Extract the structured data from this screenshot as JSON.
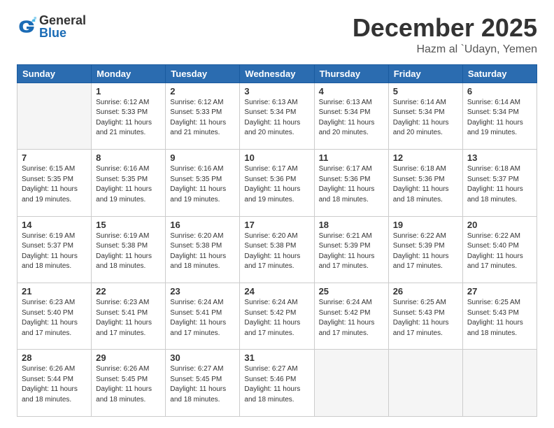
{
  "logo": {
    "general": "General",
    "blue": "Blue"
  },
  "header": {
    "month": "December 2025",
    "location": "Hazm al `Udayn, Yemen"
  },
  "days_of_week": [
    "Sunday",
    "Monday",
    "Tuesday",
    "Wednesday",
    "Thursday",
    "Friday",
    "Saturday"
  ],
  "weeks": [
    [
      {
        "day": "",
        "empty": true
      },
      {
        "day": "1",
        "sunrise": "6:12 AM",
        "sunset": "5:33 PM",
        "daylight": "11 hours and 21 minutes."
      },
      {
        "day": "2",
        "sunrise": "6:12 AM",
        "sunset": "5:33 PM",
        "daylight": "11 hours and 21 minutes."
      },
      {
        "day": "3",
        "sunrise": "6:13 AM",
        "sunset": "5:34 PM",
        "daylight": "11 hours and 20 minutes."
      },
      {
        "day": "4",
        "sunrise": "6:13 AM",
        "sunset": "5:34 PM",
        "daylight": "11 hours and 20 minutes."
      },
      {
        "day": "5",
        "sunrise": "6:14 AM",
        "sunset": "5:34 PM",
        "daylight": "11 hours and 20 minutes."
      },
      {
        "day": "6",
        "sunrise": "6:14 AM",
        "sunset": "5:34 PM",
        "daylight": "11 hours and 19 minutes."
      }
    ],
    [
      {
        "day": "7",
        "sunrise": "6:15 AM",
        "sunset": "5:35 PM",
        "daylight": "11 hours and 19 minutes."
      },
      {
        "day": "8",
        "sunrise": "6:16 AM",
        "sunset": "5:35 PM",
        "daylight": "11 hours and 19 minutes."
      },
      {
        "day": "9",
        "sunrise": "6:16 AM",
        "sunset": "5:35 PM",
        "daylight": "11 hours and 19 minutes."
      },
      {
        "day": "10",
        "sunrise": "6:17 AM",
        "sunset": "5:36 PM",
        "daylight": "11 hours and 19 minutes."
      },
      {
        "day": "11",
        "sunrise": "6:17 AM",
        "sunset": "5:36 PM",
        "daylight": "11 hours and 18 minutes."
      },
      {
        "day": "12",
        "sunrise": "6:18 AM",
        "sunset": "5:36 PM",
        "daylight": "11 hours and 18 minutes."
      },
      {
        "day": "13",
        "sunrise": "6:18 AM",
        "sunset": "5:37 PM",
        "daylight": "11 hours and 18 minutes."
      }
    ],
    [
      {
        "day": "14",
        "sunrise": "6:19 AM",
        "sunset": "5:37 PM",
        "daylight": "11 hours and 18 minutes."
      },
      {
        "day": "15",
        "sunrise": "6:19 AM",
        "sunset": "5:38 PM",
        "daylight": "11 hours and 18 minutes."
      },
      {
        "day": "16",
        "sunrise": "6:20 AM",
        "sunset": "5:38 PM",
        "daylight": "11 hours and 18 minutes."
      },
      {
        "day": "17",
        "sunrise": "6:20 AM",
        "sunset": "5:38 PM",
        "daylight": "11 hours and 17 minutes."
      },
      {
        "day": "18",
        "sunrise": "6:21 AM",
        "sunset": "5:39 PM",
        "daylight": "11 hours and 17 minutes."
      },
      {
        "day": "19",
        "sunrise": "6:22 AM",
        "sunset": "5:39 PM",
        "daylight": "11 hours and 17 minutes."
      },
      {
        "day": "20",
        "sunrise": "6:22 AM",
        "sunset": "5:40 PM",
        "daylight": "11 hours and 17 minutes."
      }
    ],
    [
      {
        "day": "21",
        "sunrise": "6:23 AM",
        "sunset": "5:40 PM",
        "daylight": "11 hours and 17 minutes."
      },
      {
        "day": "22",
        "sunrise": "6:23 AM",
        "sunset": "5:41 PM",
        "daylight": "11 hours and 17 minutes."
      },
      {
        "day": "23",
        "sunrise": "6:24 AM",
        "sunset": "5:41 PM",
        "daylight": "11 hours and 17 minutes."
      },
      {
        "day": "24",
        "sunrise": "6:24 AM",
        "sunset": "5:42 PM",
        "daylight": "11 hours and 17 minutes."
      },
      {
        "day": "25",
        "sunrise": "6:24 AM",
        "sunset": "5:42 PM",
        "daylight": "11 hours and 17 minutes."
      },
      {
        "day": "26",
        "sunrise": "6:25 AM",
        "sunset": "5:43 PM",
        "daylight": "11 hours and 17 minutes."
      },
      {
        "day": "27",
        "sunrise": "6:25 AM",
        "sunset": "5:43 PM",
        "daylight": "11 hours and 18 minutes."
      }
    ],
    [
      {
        "day": "28",
        "sunrise": "6:26 AM",
        "sunset": "5:44 PM",
        "daylight": "11 hours and 18 minutes."
      },
      {
        "day": "29",
        "sunrise": "6:26 AM",
        "sunset": "5:45 PM",
        "daylight": "11 hours and 18 minutes."
      },
      {
        "day": "30",
        "sunrise": "6:27 AM",
        "sunset": "5:45 PM",
        "daylight": "11 hours and 18 minutes."
      },
      {
        "day": "31",
        "sunrise": "6:27 AM",
        "sunset": "5:46 PM",
        "daylight": "11 hours and 18 minutes."
      },
      {
        "day": "",
        "empty": true
      },
      {
        "day": "",
        "empty": true
      },
      {
        "day": "",
        "empty": true
      }
    ]
  ]
}
